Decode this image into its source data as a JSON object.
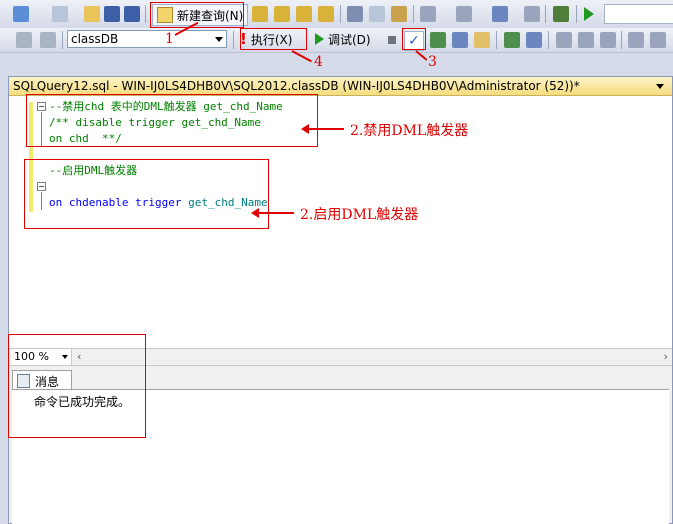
{
  "toolbar": {
    "new_query_label": "新建查询(N)",
    "database_selected": "classDB",
    "execute_label": "执行(X)",
    "debug_label": "调试(D)"
  },
  "editor": {
    "tab_title": "SQLQuery12.sql - WIN-IJ0LS4DHB0V\\SQL2012.classDB (WIN-IJ0LS4DHB0V\\Administrator (52))*",
    "line1": "--禁用chd 表中的DML触发器 get_chd_Name",
    "line2": "/** disable trigger get_chd_Name",
    "line3": "on chd  **/",
    "line4": "--启用DML触发器",
    "line5_kw": "enable trigger",
    "line5_name": "get_chd_Name",
    "line6": "on chd",
    "zoom": "100 %"
  },
  "annotations": {
    "num1": "1",
    "num3": "3",
    "num4": "4",
    "label2a": "2.禁用DML触发器",
    "label2b": "2.启用DML触发器"
  },
  "results": {
    "tab_label": "消息",
    "message": "命令已成功完成。"
  },
  "colors": {
    "annotation_red": "#e00000",
    "comment_green": "#008000",
    "keyword_blue": "#0000ff",
    "name_teal": "#008080"
  }
}
